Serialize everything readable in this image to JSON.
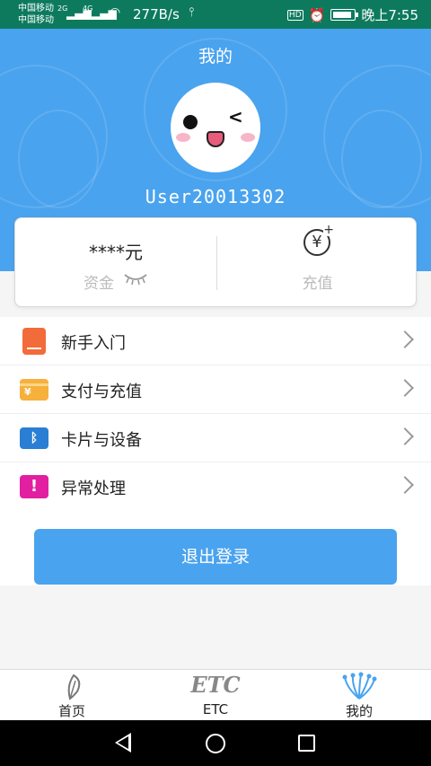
{
  "status_bar": {
    "carrier1": "中国移动",
    "carrier2": "中国移动",
    "net1": "2G",
    "net2": "4G",
    "speed": "277B/s",
    "hd": "HD",
    "time": "晚上7:55"
  },
  "header": {
    "title": "我的",
    "username": "User20013302",
    "background_color": "#4aa3ee"
  },
  "wallet": {
    "balance": "****元",
    "funds_label": "资金",
    "recharge_label": "充值",
    "recharge_icon": "yen-plus-icon",
    "eye_icon": "eye-closed-icon"
  },
  "menu": {
    "items": [
      {
        "label": "新手入门",
        "icon": "book-icon",
        "color": "#f26b3a",
        "glyph": ""
      },
      {
        "label": "支付与充值",
        "icon": "card-payment-icon",
        "color": "#f6b03c",
        "glyph": "¥"
      },
      {
        "label": "卡片与设备",
        "icon": "bluetooth-icon",
        "color": "#2a7fd4",
        "glyph": "ᛒ"
      },
      {
        "label": "异常处理",
        "icon": "exclamation-icon",
        "color": "#e21fa0",
        "glyph": "!"
      }
    ]
  },
  "logout": {
    "label": "退出登录"
  },
  "tabbar": {
    "tabs": [
      {
        "label": "首页",
        "icon": "feather-icon"
      },
      {
        "label": "ETC",
        "icon": "etc-logo-icon",
        "logo_text": "ETC"
      },
      {
        "label": "我的",
        "icon": "peacock-icon"
      }
    ]
  }
}
